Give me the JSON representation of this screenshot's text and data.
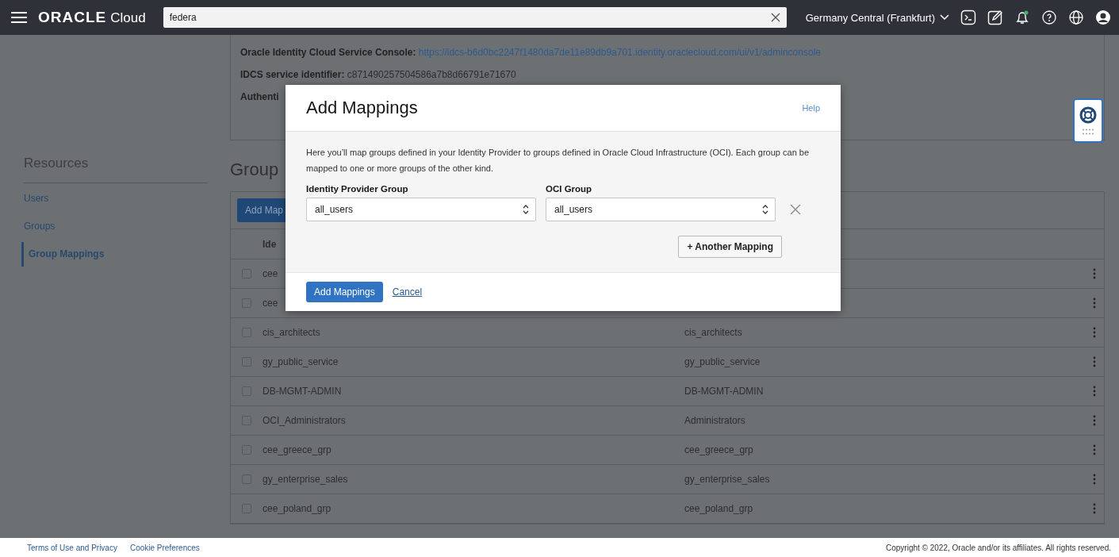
{
  "header": {
    "brand": "ORACLE",
    "brand_suffix": "Cloud",
    "search": {
      "value": "federa"
    },
    "region": "Germany Central (Frankfurt)"
  },
  "details": {
    "lines": [
      {
        "label": "Oracle Identity Cloud Service Console:",
        "value": "https://idcs-b6d0bc2247f1480da7de11e89db9a701.identity.oraclecloud.com/ui/v1/adminconsole",
        "kind": "link"
      },
      {
        "label": "IDCS service identifier:",
        "value": "c871490257504586a7b8d66791e71670",
        "kind": "text"
      },
      {
        "label": "Authenti"
      }
    ]
  },
  "sidebar": {
    "title": "Resources",
    "items": [
      {
        "label": "Users",
        "selected": false
      },
      {
        "label": "Groups",
        "selected": false
      },
      {
        "label": "Group Mappings",
        "selected": true
      }
    ]
  },
  "main": {
    "heading": "Group",
    "toolbar_button": "Add Map",
    "columns": [
      "Ide"
    ],
    "rows": [
      {
        "column_1": "cee",
        "checked": false
      },
      {
        "column_1": "cee",
        "checked": false
      },
      {
        "column_1": "cis_architects",
        "column_2": "cis_architects",
        "checked": false
      },
      {
        "column_1": "gy_public_service",
        "column_2": "gy_public_service",
        "checked": false
      },
      {
        "column_1": "DB-MGMT-ADMIN",
        "column_2": "DB-MGMT-ADMIN",
        "checked": false
      },
      {
        "column_1": "OCI_Administrators",
        "column_2": "Administrators",
        "checked": false
      },
      {
        "column_1": "cee_greece_grp",
        "column_2": "cee_greece_grp",
        "checked": false
      },
      {
        "column_1": "gy_enterprise_sales",
        "column_2": "gy_enterprise_sales",
        "checked": false
      },
      {
        "column_1": "cee_poland_grp",
        "column_2": "cee_poland_grp",
        "checked": false
      }
    ]
  },
  "dialog": {
    "title": "Add Mappings",
    "help": "Help",
    "description": "Here you’ll map groups defined in your Identity Provider to groups defined in Oracle Cloud Infrastructure (OCI). Each group can be mapped to one or more groups of the other kind.",
    "mapping": {
      "idp_label": "Identity Provider Group",
      "idp_value": "all_users",
      "oci_label": "OCI Group",
      "oci_value": "all_users"
    },
    "another_button": "+ Another Mapping",
    "primary_button": "Add Mappings",
    "cancel": "Cancel"
  },
  "footer": {
    "links": [
      "Terms of Use and Privacy",
      "Cookie Preferences"
    ],
    "copyright": "Copyright © 2022, Oracle and/or its affiliates. All rights reserved."
  }
}
